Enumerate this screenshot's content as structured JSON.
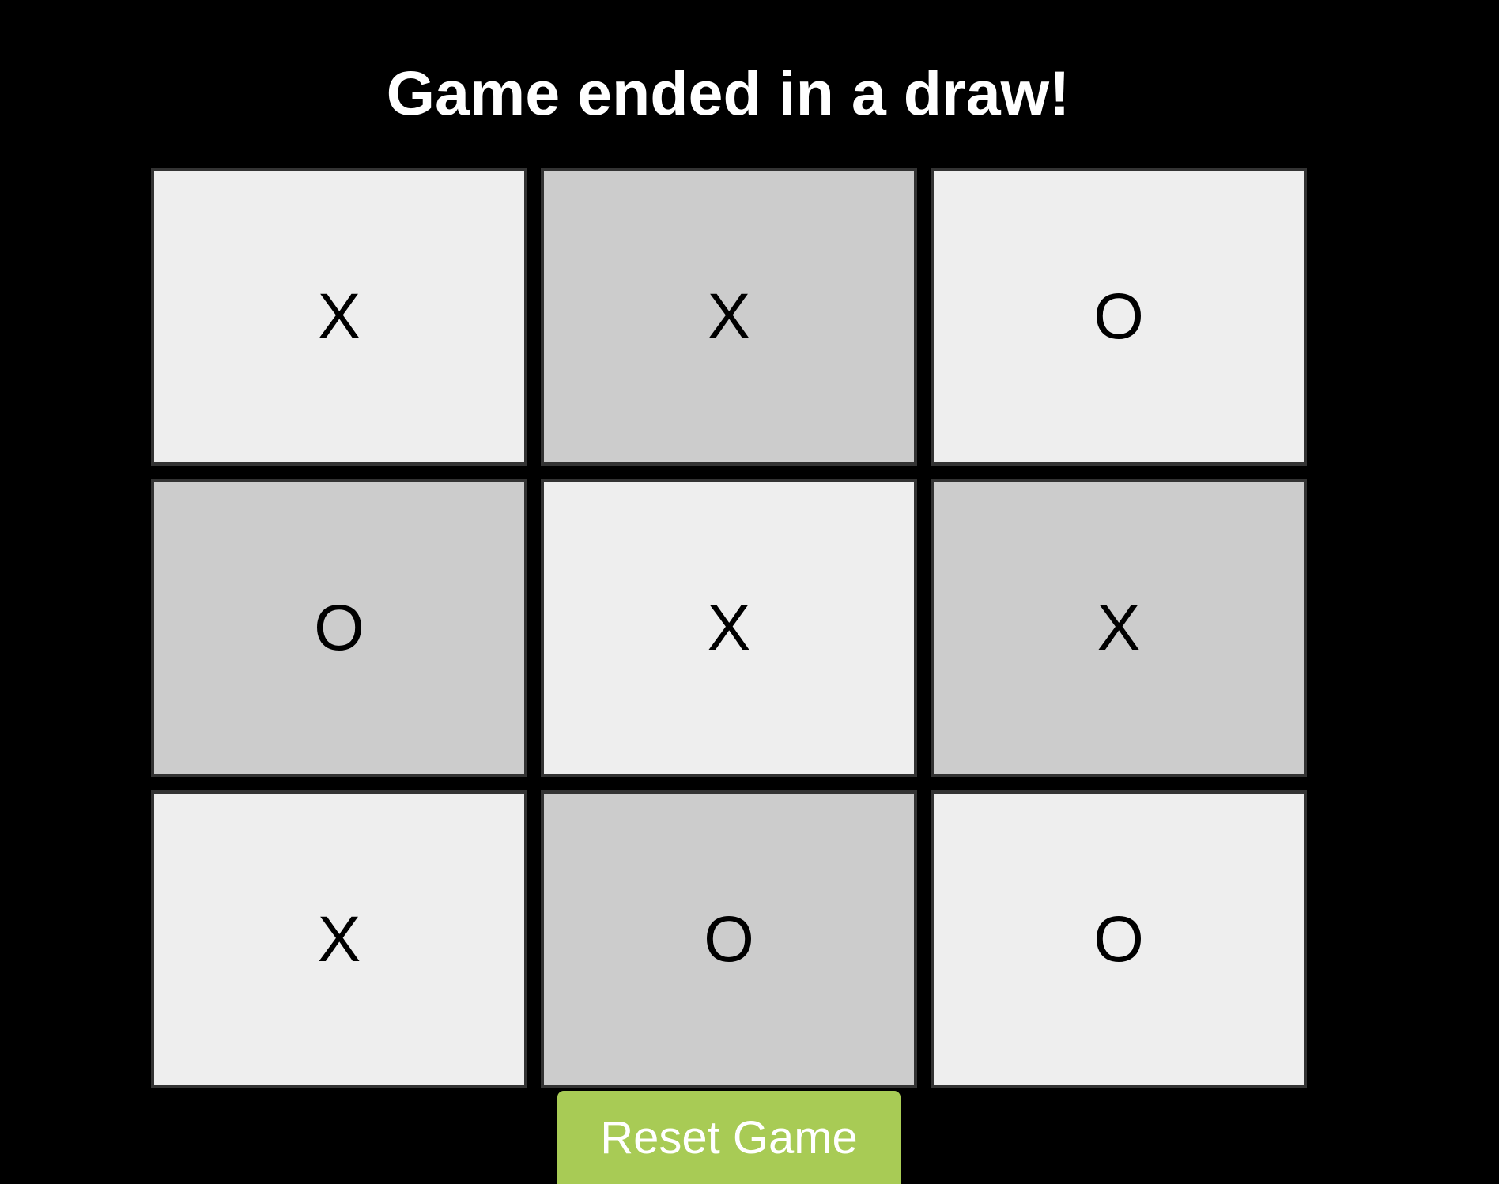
{
  "status": {
    "message": "Game ended in a draw!"
  },
  "board": {
    "cells": [
      {
        "mark": "X",
        "shade": "light"
      },
      {
        "mark": "X",
        "shade": "dark"
      },
      {
        "mark": "O",
        "shade": "light"
      },
      {
        "mark": "O",
        "shade": "dark"
      },
      {
        "mark": "X",
        "shade": "light"
      },
      {
        "mark": "X",
        "shade": "dark"
      },
      {
        "mark": "X",
        "shade": "light"
      },
      {
        "mark": "O",
        "shade": "dark"
      },
      {
        "mark": "O",
        "shade": "light"
      }
    ]
  },
  "controls": {
    "reset_label": "Reset Game"
  },
  "colors": {
    "background": "#000000",
    "cell_light": "#eeeeee",
    "cell_dark": "#cccccc",
    "cell_border": "#333333",
    "button": "#a8cb55",
    "status_text": "#ffffff"
  }
}
